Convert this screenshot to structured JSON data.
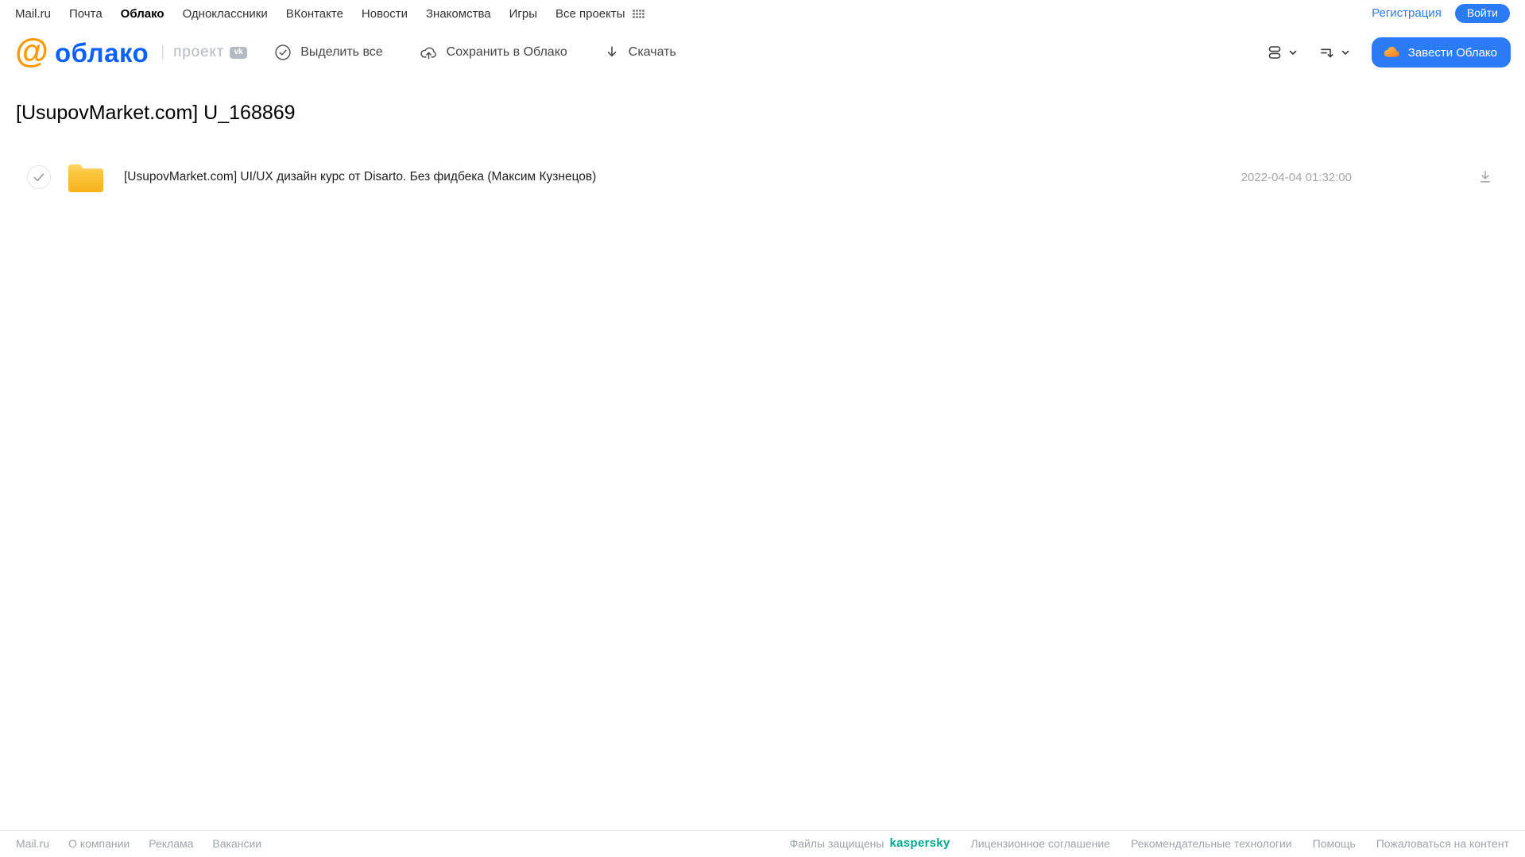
{
  "portal_nav": {
    "links": [
      {
        "label": "Mail.ru"
      },
      {
        "label": "Почта"
      },
      {
        "label": "Облако"
      },
      {
        "label": "Одноклассники"
      },
      {
        "label": "ВКонтакте"
      },
      {
        "label": "Новости"
      },
      {
        "label": "Знакомства"
      },
      {
        "label": "Игры"
      },
      {
        "label": "Все проекты"
      }
    ],
    "active_link": "Облако",
    "registration_label": "Регистрация",
    "login_label": "Войти"
  },
  "header": {
    "logo_at": "@",
    "logo_text": "облако",
    "project_label": "проект",
    "vk_badge": "vk",
    "select_all_label": "Выделить все",
    "save_to_cloud_label": "Сохранить в Облако",
    "download_label": "Скачать",
    "get_cloud_button_label": "Завести Облако"
  },
  "page": {
    "title": "[UsupovMarket.com] U_168869"
  },
  "file_list": {
    "rows": [
      {
        "type": "folder",
        "name": "[UsupovMarket.com] UI/UX дизайн курс от Disarto. Без фидбека (Максим Кузнецов)",
        "modified": "2022-04-04 01:32:00"
      }
    ]
  },
  "footer": {
    "left_links": [
      {
        "label": "Mail.ru"
      },
      {
        "label": "О компании"
      },
      {
        "label": "Реклама"
      },
      {
        "label": "Вакансии"
      }
    ],
    "protected_text": "Файлы защищены",
    "kaspersky_label": "kaspersky",
    "right_links": [
      {
        "label": "Лицензионное соглашение"
      },
      {
        "label": "Рекомендательные технологии"
      },
      {
        "label": "Помощь"
      },
      {
        "label": "Пожаловаться на контент"
      }
    ]
  },
  "colors": {
    "accent_blue": "#2b7af6",
    "logo_blue": "#0b61fe",
    "logo_orange": "#ff9900",
    "folder_yellow": "#fbbf33",
    "kaspersky_green": "#00a88e",
    "muted_gray": "#9ea4ab"
  }
}
